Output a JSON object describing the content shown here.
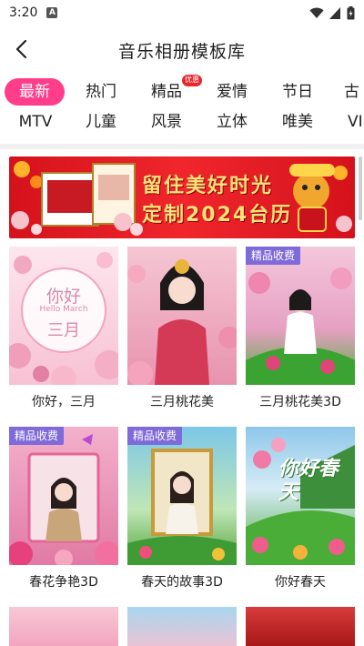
{
  "status": {
    "time": "3:20",
    "notif_icon": "a-notification-icon"
  },
  "header": {
    "title": "音乐相册模板库",
    "back_icon": "back-arrow-icon"
  },
  "tabs_row1": [
    {
      "label": "最新",
      "active": true
    },
    {
      "label": "热门"
    },
    {
      "label": "精品",
      "badge": "优惠"
    },
    {
      "label": "爱情"
    },
    {
      "label": "节日"
    },
    {
      "label": "古"
    }
  ],
  "tabs_row2": [
    {
      "label": "MTV"
    },
    {
      "label": "儿童"
    },
    {
      "label": "风景"
    },
    {
      "label": "立体"
    },
    {
      "label": "唯美"
    },
    {
      "label": "VI"
    }
  ],
  "banner": {
    "line1": "留住美好时光",
    "line2": "定制2024台历"
  },
  "cards": [
    {
      "caption": "你好，三月",
      "overlay_title": "你好",
      "overlay_sub": "Hello March",
      "overlay_month": "三月"
    },
    {
      "caption": "三月桃花美"
    },
    {
      "caption": "三月桃花美3D",
      "tag": "精品收费"
    },
    {
      "caption": "春花争艳3D",
      "tag": "精品收费"
    },
    {
      "caption": "春天的故事3D",
      "tag": "精品收费"
    },
    {
      "caption": "你好春天",
      "overlay_text": "你好春天"
    }
  ],
  "colors": {
    "accent": "#ff3d8b",
    "tag_bg": "#7f6ad9",
    "badge": "#e8262d",
    "banner_red": "#e01a22"
  }
}
